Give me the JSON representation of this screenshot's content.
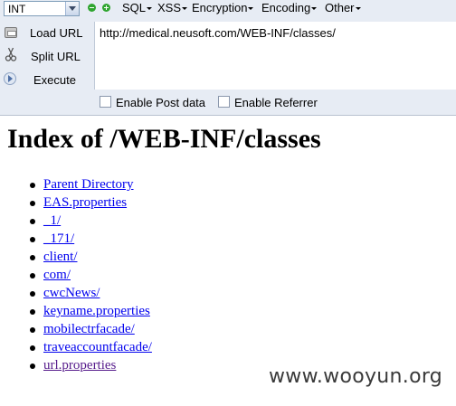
{
  "hackbar": {
    "select_value": "INT",
    "menus": [
      "SQL",
      "XSS",
      "Encryption",
      "Encoding",
      "Other"
    ],
    "actions": {
      "load_url": "Load URL",
      "split_url": "Split URL",
      "execute": "Execute"
    },
    "url_value": "http://medical.neusoft.com/WEB-INF/classes/",
    "checkboxes": {
      "post_data": "Enable Post data",
      "referrer": "Enable Referrer"
    }
  },
  "page": {
    "title": "Index of /WEB-INF/classes",
    "entries": [
      "Parent Directory",
      "EAS.properties",
      "_1/",
      "_171/",
      "client/",
      "com/",
      "cwcNews/",
      "keyname.properties",
      "mobilectrfacade/",
      "traveaccountfacade/",
      "url.properties"
    ]
  },
  "watermark": "www.wooyun.org"
}
